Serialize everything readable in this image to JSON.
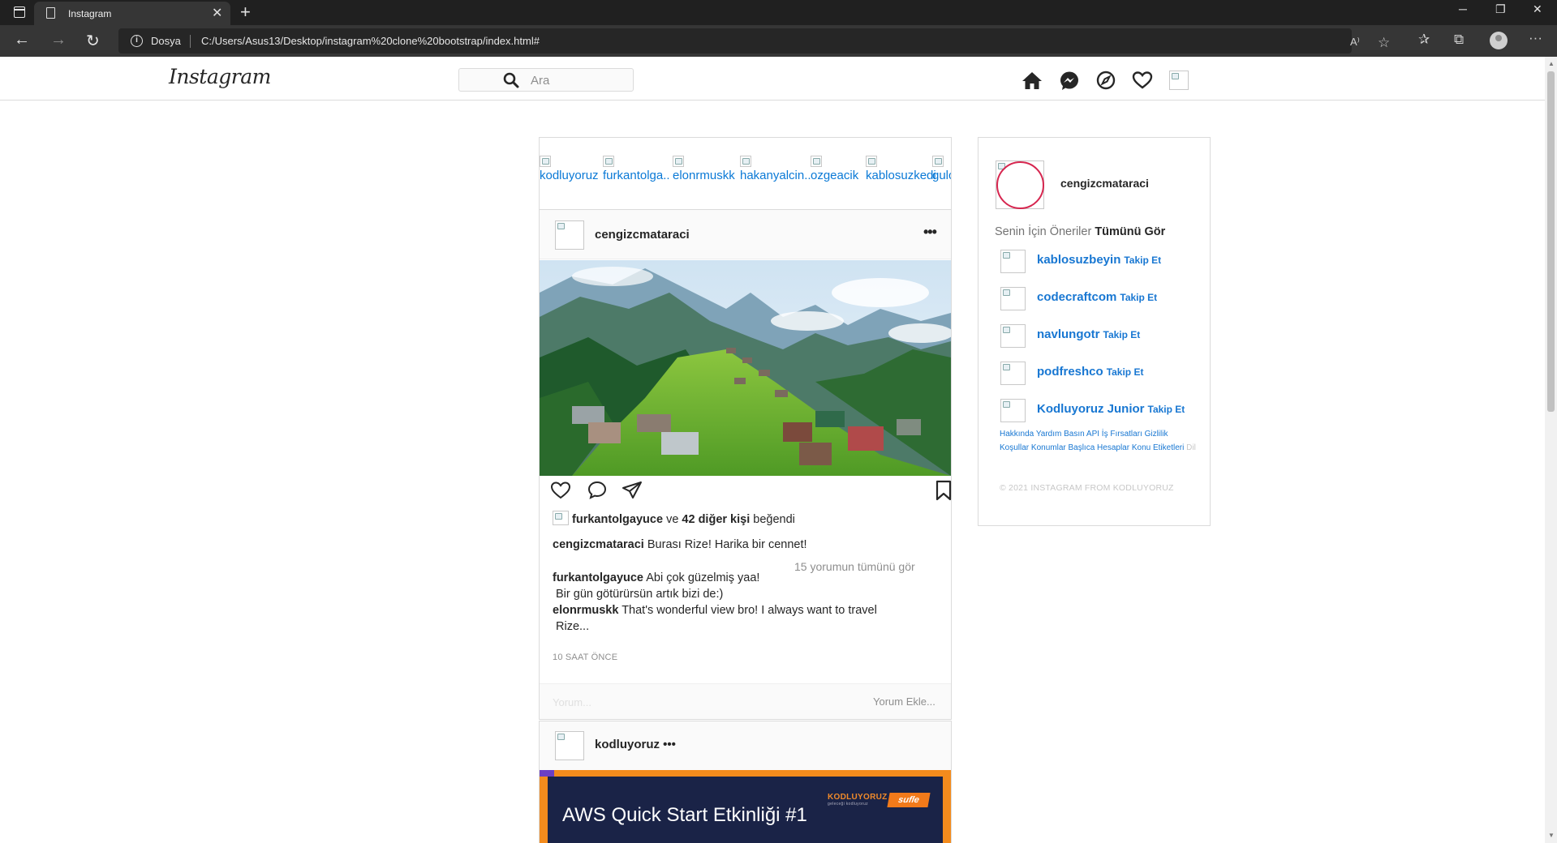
{
  "browser": {
    "tab_title": "Instagram",
    "new_tab_symbol": "+",
    "site_info_label": "Dosya",
    "url": "C:/Users/Asus13/Desktop/instagram%20clone%20bootstrap/index.html#"
  },
  "nav": {
    "logo": "Instagram",
    "search_placeholder": "Ara",
    "icons": [
      "home-icon",
      "messenger-icon",
      "explore-icon",
      "heart-icon",
      "profile-image"
    ]
  },
  "stories": [
    {
      "label": "kodluyoruz"
    },
    {
      "label": "furkantolga.."
    },
    {
      "label": "elonrmuskk"
    },
    {
      "label": "hakanyalcin.."
    },
    {
      "label": "ozgeacik"
    },
    {
      "label": "kablosuzkedi"
    },
    {
      "label": "gulcan"
    }
  ],
  "post": {
    "username": "cengizcmataraci",
    "more": "•••",
    "likes": {
      "user": "furkantolgayuce",
      "connector": "ve",
      "others": "42 diğer kişi",
      "suffix": "beğendi"
    },
    "caption": {
      "user": "cengizcmataraci",
      "text": "Burası Rize! Harika bir cennet!"
    },
    "view_all": "15 yorumun tümünü gör",
    "comments": [
      {
        "user": "furkantolgayuce",
        "text": "Abi çok güzelmiş yaa!",
        "text2": "Bir gün götürürsün artık bizi de:)"
      },
      {
        "user": "elonrmuskk",
        "text": "That's wonderful view bro! I always want to travel",
        "text2": "Rize..."
      }
    ],
    "time": "10 SAAT ÖNCE",
    "comment_placeholder": "Yorum...",
    "add_comment": "Yorum Ekle..."
  },
  "post2": {
    "username": "kodluyoruz •••",
    "banner_title": "AWS Quick Start Etkinliği #1",
    "banner_brand": "KODLUYORUZ",
    "banner_brand_sub": "geleceği kodluyoruz",
    "banner_partner": "sufle"
  },
  "sidebar": {
    "username": "cengizcmataraci",
    "suggestions_label": "Senin İçin Öneriler",
    "see_all": "Tümünü Gör",
    "follow_label": "Takip Et",
    "suggestions": [
      {
        "name": "kablosuzbeyin"
      },
      {
        "name": "codecraftcom"
      },
      {
        "name": "navlungotr"
      },
      {
        "name": "podfreshco"
      },
      {
        "name": "Kodluyoruz Junior"
      }
    ],
    "footer_links": "Hakkında Yardım Basın API İş Fırsatları Gizlilik Koşullar Konumlar Başlıca Hesaplar Konu Etiketleri",
    "footer_lang": "Dil",
    "copyright": "© 2021 INSTAGRAM FROM KODLUYORUZ"
  },
  "colors": {
    "link_blue": "#1877d2",
    "story_blue": "#0a79d6",
    "ring_red": "#d6264f",
    "banner_orange": "#f38b1d",
    "banner_navy": "#1a2347"
  }
}
